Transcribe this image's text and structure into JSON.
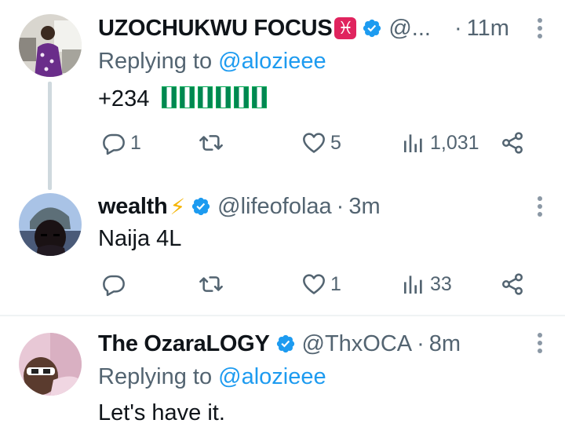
{
  "tweets": [
    {
      "name": "UZOCHUKWU FOCUS",
      "name_emoji": "♓",
      "handle": "@...",
      "time": "11m",
      "replying_prefix": "Replying to",
      "replying_mention": "@alozieee",
      "text": "+234",
      "flags_count": 6,
      "replies": "1",
      "retweets": "",
      "likes": "5",
      "views": "1,031"
    },
    {
      "name": "wealth",
      "name_emoji": "⚡",
      "handle": "@lifeofolaa",
      "time": "3m",
      "text": "Naija 4L",
      "replies": "",
      "retweets": "",
      "likes": "1",
      "views": "33"
    },
    {
      "name": "The OzaraLOGY",
      "handle": "@ThxOCA",
      "time": "8m",
      "replying_prefix": "Replying to",
      "replying_mention": "@alozieee",
      "text": "Let's have it."
    }
  ],
  "colors": {
    "verified": "#1d9bf0",
    "mention": "#1d9bf0",
    "secondary_text": "#536471",
    "zodiac_badge": "#e0245e"
  },
  "icons": [
    "reply-icon",
    "retweet-icon",
    "like-icon",
    "views-icon",
    "share-icon",
    "verified-badge-icon",
    "more-icon"
  ]
}
